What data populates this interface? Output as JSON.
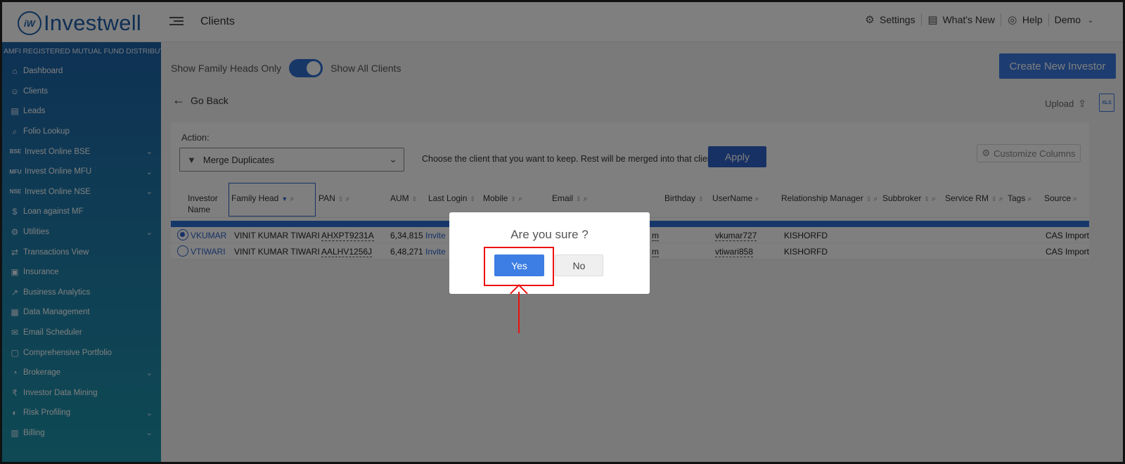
{
  "header": {
    "logo_mark": "iW",
    "logo_text": "Investwell",
    "page_title": "Clients",
    "links": [
      {
        "icon": "gear-icon",
        "label": "Settings"
      },
      {
        "icon": "whats-new-icon",
        "label": "What's New"
      },
      {
        "icon": "help-icon",
        "label": "Help"
      }
    ],
    "user_menu": "Demo"
  },
  "sidebar": {
    "tagline": "AMFI REGISTERED MUTUAL FUND DISTRIBUTOR",
    "items": [
      {
        "label": "Dashboard",
        "icon": "home-icon",
        "expandable": false
      },
      {
        "label": "Clients",
        "icon": "users-icon",
        "expandable": false
      },
      {
        "label": "Leads",
        "icon": "leads-icon",
        "expandable": false
      },
      {
        "label": "Folio Lookup",
        "icon": "folio-lookup-icon",
        "expandable": false
      },
      {
        "label": "Invest Online BSE",
        "icon_text": "BSE",
        "expandable": true
      },
      {
        "label": "Invest Online MFU",
        "icon_text": "MFU",
        "expandable": true
      },
      {
        "label": "Invest Online NSE",
        "icon_text": "NSE",
        "expandable": true
      },
      {
        "label": "Loan against MF",
        "icon": "loan-icon",
        "expandable": false
      },
      {
        "label": "Utilities",
        "icon": "utilities-icon",
        "expandable": true
      },
      {
        "label": "Transactions View",
        "icon": "transactions-icon",
        "expandable": false
      },
      {
        "label": "Insurance",
        "icon": "insurance-icon",
        "expandable": false
      },
      {
        "label": "Business Analytics",
        "icon": "analytics-icon",
        "expandable": false
      },
      {
        "label": "Data Management",
        "icon": "data-management-icon",
        "expandable": false
      },
      {
        "label": "Email Scheduler",
        "icon": "email-scheduler-icon",
        "expandable": false
      },
      {
        "label": "Comprehensive Portfolio",
        "icon": "portfolio-icon",
        "expandable": false
      },
      {
        "label": "Brokerage",
        "icon": "brokerage-icon",
        "expandable": true
      },
      {
        "label": "Investor Data Mining",
        "icon": "data-mining-icon",
        "expandable": false
      },
      {
        "label": "Risk Profiling",
        "icon": "risk-profiling-icon",
        "expandable": true
      },
      {
        "label": "Billing",
        "icon": "billing-icon",
        "expandable": true
      }
    ]
  },
  "main": {
    "toggle_left": "Show Family Heads Only",
    "toggle_right": "Show All Clients",
    "create_button": "Create New Investor",
    "go_back": "Go Back",
    "upload": "Upload",
    "xls_label": "XLS",
    "action": {
      "label": "Action:",
      "selected": "Merge Duplicates",
      "hint": "Choose the client that you want to keep. Rest will be merged into that client.",
      "apply": "Apply",
      "customize": "Customize Columns"
    },
    "table": {
      "headers": {
        "investor_name_1": "Investor",
        "investor_name_2": "Name",
        "family_head": "Family Head",
        "pan": "PAN",
        "aum": "AUM",
        "last_login": "Last Login",
        "mobile": "Mobile",
        "email": "Email",
        "birthday": "Birthday",
        "username": "UserName",
        "relationship_manager": "Relationship Manager",
        "subbroker": "Subbroker",
        "service_rm": "Service RM",
        "tags": "Tags",
        "source": "Source"
      },
      "rows": [
        {
          "selected": true,
          "investor": "VKUMAR",
          "family_head": "VINIT KUMAR TIWARI",
          "pan": "AHXPT9231A",
          "aum": "6,34,815",
          "last_login": "Invite",
          "email_tail": "m",
          "username": "vkumar727",
          "rm": "KISHORFD",
          "source": "CAS Import"
        },
        {
          "selected": false,
          "investor": "VTIWARI",
          "family_head": "VINIT KUMAR TIWARI",
          "pan": "AALHV1256J",
          "aum": "6,48,271",
          "last_login": "Invite",
          "email_tail": "m",
          "username": "vtiwari858",
          "rm": "KISHORFD",
          "source": "CAS Import"
        }
      ]
    }
  },
  "modal": {
    "title": "Are you sure ?",
    "yes": "Yes",
    "no": "No"
  },
  "colors": {
    "accent": "#2f63c9",
    "annotation": "#ee1111"
  }
}
